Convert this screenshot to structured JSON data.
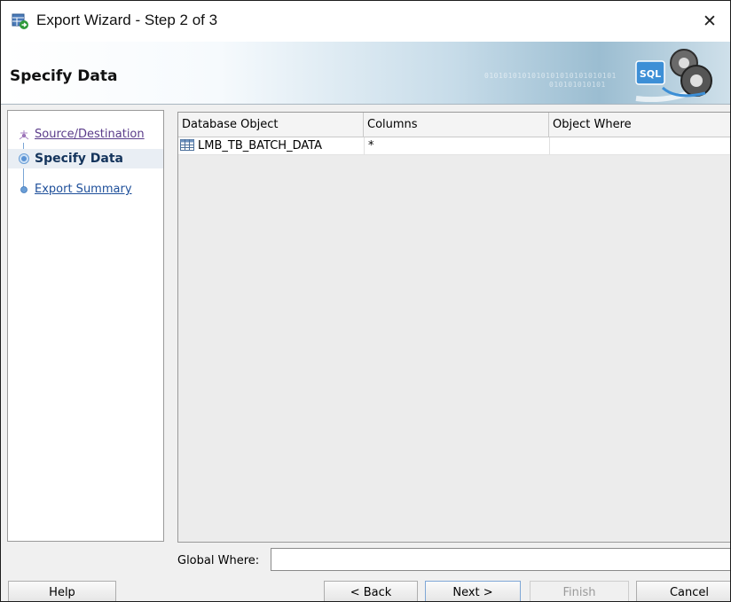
{
  "window": {
    "title": "Export Wizard - Step 2 of 3",
    "close_glyph": "✕"
  },
  "header": {
    "title": "Specify Data",
    "decor_binary_1": "0101010101010101010101010101",
    "decor_binary_2": "010101010101"
  },
  "nav": {
    "items": [
      {
        "label": "Source/Destination",
        "state": "visited"
      },
      {
        "label": "Specify Data",
        "state": "current"
      },
      {
        "label": "Export Summary",
        "state": "next"
      }
    ]
  },
  "table": {
    "headers": [
      "Database Object",
      "Columns",
      "Object Where"
    ],
    "rows": [
      {
        "object": "LMB_TB_BATCH_DATA",
        "columns": "*",
        "where": ""
      }
    ]
  },
  "global_where": {
    "label": "Global Where:",
    "value": ""
  },
  "buttons": {
    "help": "Help",
    "back": "< Back",
    "next": "Next >",
    "finish": "Finish",
    "cancel": "Cancel"
  },
  "icons": {
    "app": "export-wizard-icon",
    "close": "close-icon",
    "table": "table-icon",
    "header_art": "sql-gears-icon"
  },
  "colors": {
    "visited_link": "#5a3b8a",
    "link": "#1e4f9a",
    "current": "#14345c"
  }
}
